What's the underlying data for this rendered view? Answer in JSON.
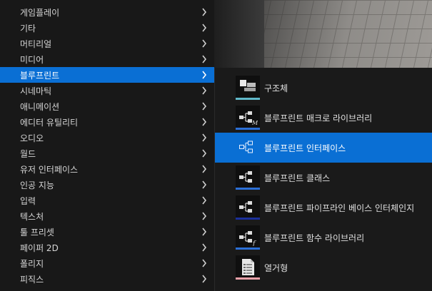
{
  "main_menu": {
    "items": [
      {
        "label": "게임플레이"
      },
      {
        "label": "기타"
      },
      {
        "label": "머티리얼"
      },
      {
        "label": "미디어"
      },
      {
        "label": "블루프린트",
        "active": true
      },
      {
        "label": "시네마틱"
      },
      {
        "label": "애니메이션"
      },
      {
        "label": "에디터 유틸리티"
      },
      {
        "label": "오디오"
      },
      {
        "label": "월드"
      },
      {
        "label": "유저 인터페이스"
      },
      {
        "label": "인공 지능"
      },
      {
        "label": "입력"
      },
      {
        "label": "텍스처"
      },
      {
        "label": "툴 프리셋"
      },
      {
        "label": "페이퍼 2D"
      },
      {
        "label": "폴리지"
      },
      {
        "label": "피직스"
      }
    ]
  },
  "submenu": {
    "items": [
      {
        "label": "구조체",
        "icon": "struct-icon",
        "accent": "#5fb8c9"
      },
      {
        "label": "블루프린트 매크로 라이브러리",
        "icon": "blueprint-macro-library-icon",
        "accent": "#2b6fd6",
        "badge": "M"
      },
      {
        "label": "블루프린트 인터페이스",
        "icon": "blueprint-interface-icon",
        "accent": "#2b6fd6",
        "active": true
      },
      {
        "label": "블루프린트 클래스",
        "icon": "blueprint-class-icon",
        "accent": "#2b6fd6"
      },
      {
        "label": "블루프린트 파이프라인 베이스 인터체인지",
        "icon": "blueprint-pipeline-icon",
        "accent": "#1a2f9a"
      },
      {
        "label": "블루프린트 함수 라이브러리",
        "icon": "blueprint-function-library-icon",
        "accent": "#2b6fd6",
        "badge": "f"
      },
      {
        "label": "열거형",
        "icon": "enum-icon",
        "accent": "#e8a0a8"
      }
    ]
  },
  "colors": {
    "highlight": "#0a6fd4",
    "menu_bg": "#181818"
  }
}
